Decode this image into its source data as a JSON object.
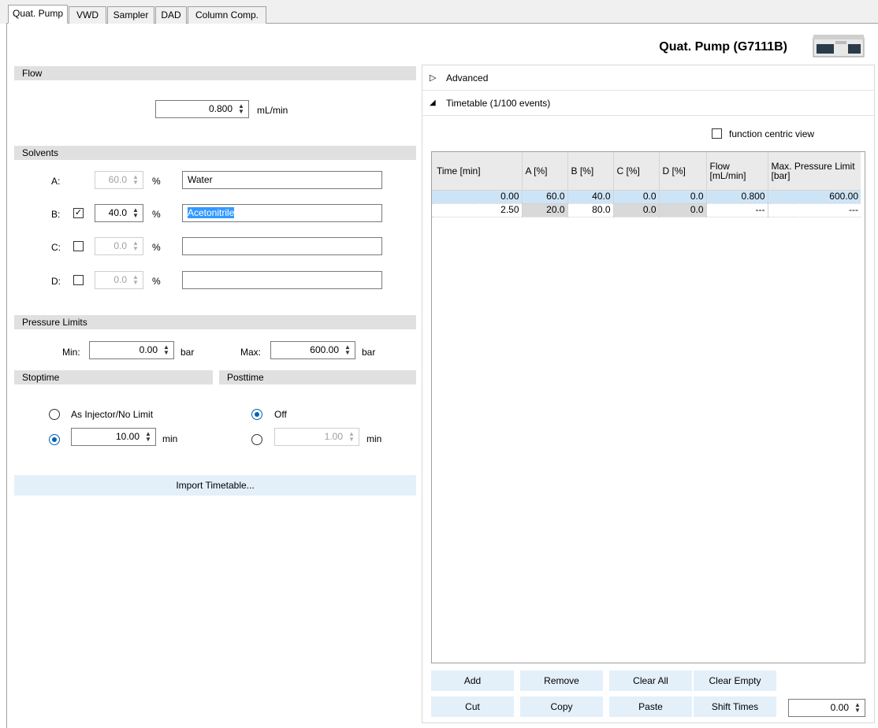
{
  "tabs": [
    "Quat. Pump",
    "VWD",
    "Sampler",
    "DAD",
    "Column Comp."
  ],
  "header": {
    "title": "Quat. Pump (G7111B)"
  },
  "flow": {
    "section": "Flow",
    "value": "0.800",
    "unit": "mL/min"
  },
  "solvents": {
    "section": "Solvents",
    "rows": [
      {
        "letter": "A:",
        "value": "60.0",
        "pct": "%",
        "name": "Water"
      },
      {
        "letter": "B:",
        "value": "40.0",
        "pct": "%",
        "name": "Acetonitrile"
      },
      {
        "letter": "C:",
        "value": "0.0",
        "pct": "%",
        "name": ""
      },
      {
        "letter": "D:",
        "value": "0.0",
        "pct": "%",
        "name": ""
      }
    ]
  },
  "pressure": {
    "section": "Pressure Limits",
    "min_label": "Min:",
    "min": "0.00",
    "max_label": "Max:",
    "max": "600.00",
    "unit": "bar"
  },
  "stoptime": {
    "section": "Stoptime",
    "opt1": "As Injector/No Limit",
    "value": "10.00",
    "unit": "min"
  },
  "posttime": {
    "section": "Posttime",
    "opt1": "Off",
    "value": "1.00",
    "unit": "min"
  },
  "import_button": "Import Timetable...",
  "advanced": "Advanced",
  "timetable": {
    "label": "Timetable (1/100 events)",
    "function_view": "function centric view",
    "columns": [
      "Time [min]",
      "A [%]",
      "B [%]",
      "C [%]",
      "D [%]",
      "Flow [mL/min]",
      "Max. Pressure Limit [bar]"
    ],
    "rows": [
      [
        "0.00",
        "60.0",
        "40.0",
        "0.0",
        "0.0",
        "0.800",
        "600.00"
      ],
      [
        "2.50",
        "20.0",
        "80.0",
        "0.0",
        "0.0",
        "---",
        "---"
      ]
    ],
    "buttons": {
      "add": "Add",
      "remove": "Remove",
      "clear_all": "Clear All",
      "clear_empty": "Clear Empty",
      "cut": "Cut",
      "copy": "Copy",
      "paste": "Paste",
      "shift_times": "Shift Times"
    },
    "shift_value": "0.00"
  }
}
